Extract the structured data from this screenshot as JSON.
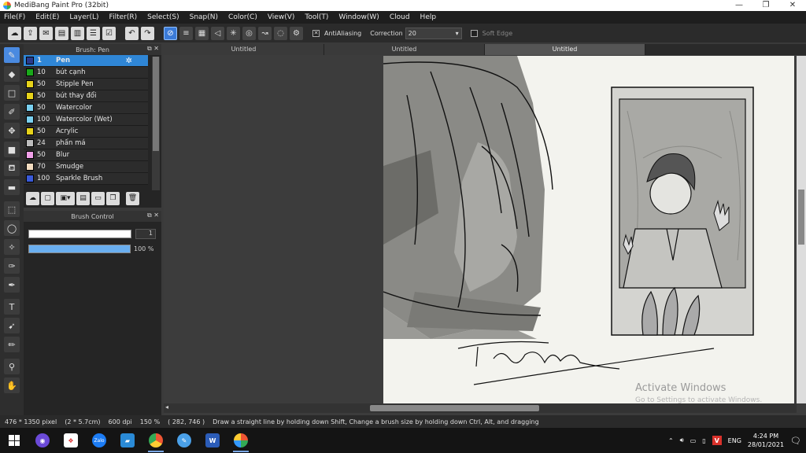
{
  "window": {
    "title": "MediBang Paint Pro (32bit)",
    "minimize": "—",
    "maximize": "❐",
    "close": "✕"
  },
  "menu": [
    "File(F)",
    "Edit(E)",
    "Layer(L)",
    "Filter(R)",
    "Select(S)",
    "Snap(N)",
    "Color(C)",
    "View(V)",
    "Tool(T)",
    "Window(W)",
    "Cloud",
    "Help"
  ],
  "toolbar": {
    "antialiasing_label": "AntiAliasing",
    "antialiasing_checked": true,
    "correction_label": "Correction",
    "correction_value": "20",
    "soft_edge_label": "Soft Edge",
    "soft_edge_checked": false
  },
  "brush_panel": {
    "title": "Brush: Pen",
    "items": [
      {
        "size": "1",
        "name": "Pen",
        "color": "#2a3a8a",
        "selected": true
      },
      {
        "size": "10",
        "name": "bút cạnh",
        "color": "#1aa81a"
      },
      {
        "size": "50",
        "name": "Stipple Pen",
        "color": "#e6d21a"
      },
      {
        "size": "50",
        "name": "bút thay đổi",
        "color": "#e6d21a"
      },
      {
        "size": "50",
        "name": "Watercolor",
        "color": "#7ad0f0"
      },
      {
        "size": "100",
        "name": "Watercolor (Wet)",
        "color": "#7ad0f0"
      },
      {
        "size": "50",
        "name": "Acrylic",
        "color": "#e6d21a"
      },
      {
        "size": "24",
        "name": "phấn má",
        "color": "#bdbdbd"
      },
      {
        "size": "50",
        "name": "Blur",
        "color": "#f0a0e8"
      },
      {
        "size": "70",
        "name": "Smudge",
        "color": "#f3dcc0"
      },
      {
        "size": "100",
        "name": "Sparkle Brush",
        "color": "#3a5ad8"
      }
    ]
  },
  "brush_control": {
    "title": "Brush Control",
    "size_value": "1",
    "opacity_value": "100",
    "opacity_unit": "%"
  },
  "tabs": [
    "Untitled",
    "Untitled",
    "Untitled"
  ],
  "active_tab": 2,
  "watermark": {
    "line1": "Activate Windows",
    "line2": "Go to Settings to activate Windows."
  },
  "status": {
    "size": "476 * 1350 pixel",
    "physical": "(2 * 5.7cm)",
    "dpi": "600 dpi",
    "zoom": "150 %",
    "coords": "( 282, 746 )",
    "hint": "Draw a straight line by holding down Shift, Change a brush size by holding down Ctrl, Alt, and dragging"
  },
  "taskbar": {
    "language": "ENG",
    "time": "4:24 PM",
    "date": "28/01/2021"
  }
}
